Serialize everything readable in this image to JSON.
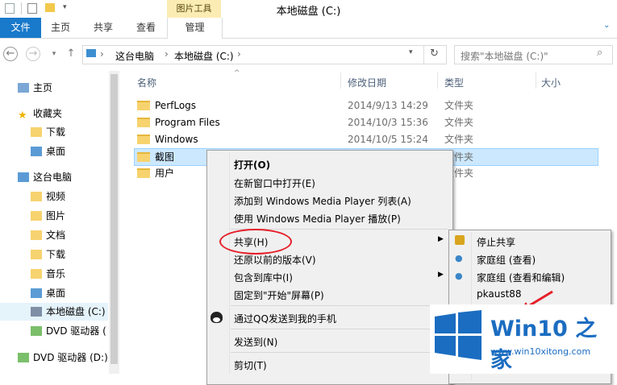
{
  "window": {
    "title": "本地磁盘 (C:)",
    "context_tab_label": "图片工具"
  },
  "ribbon": {
    "file": "文件",
    "tabs": [
      "主页",
      "共享",
      "查看"
    ],
    "manage": "管理"
  },
  "address": {
    "path": [
      "这台电脑",
      "本地磁盘 (C:)"
    ],
    "search_placeholder": "搜索\"本地磁盘 (C:)\""
  },
  "nav": {
    "items": [
      {
        "label": "主页",
        "icon": "home-icon"
      },
      {
        "label": "收藏夹",
        "icon": "star-icon"
      },
      {
        "label": "下载",
        "icon": "download-folder-icon"
      },
      {
        "label": "桌面",
        "icon": "desktop-icon"
      },
      {
        "label": "这台电脑",
        "icon": "computer-icon"
      },
      {
        "label": "视频",
        "icon": "video-folder-icon"
      },
      {
        "label": "图片",
        "icon": "pictures-folder-icon"
      },
      {
        "label": "文档",
        "icon": "documents-folder-icon"
      },
      {
        "label": "下载",
        "icon": "download-folder-icon"
      },
      {
        "label": "音乐",
        "icon": "music-folder-icon"
      },
      {
        "label": "桌面",
        "icon": "desktop-icon"
      },
      {
        "label": "本地磁盘 (C:)",
        "icon": "drive-icon"
      },
      {
        "label": "DVD 驱动器 (",
        "icon": "dvd-drive-icon"
      },
      {
        "label": "DVD 驱动器 (D:)",
        "icon": "dvd-drive-icon"
      }
    ]
  },
  "columns": {
    "name": "名称",
    "modified": "修改日期",
    "type": "类型",
    "size": "大小"
  },
  "files": [
    {
      "name": "PerfLogs",
      "modified": "2014/9/13 14:29",
      "type": "文件夹"
    },
    {
      "name": "Program Files",
      "modified": "2014/10/3 15:36",
      "type": "文件夹"
    },
    {
      "name": "Windows",
      "modified": "2014/10/5 15:24",
      "type": "文件夹"
    },
    {
      "name": "截图",
      "modified": "",
      "type": "文件夹"
    },
    {
      "name": "用户",
      "modified": "",
      "type": "文件夹"
    }
  ],
  "context_menu": {
    "items": [
      "打开(O)",
      "在新窗口中打开(E)",
      "添加到 Windows Media Player 列表(A)",
      "使用 Windows Media Player 播放(P)",
      "共享(H)",
      "还原以前的版本(V)",
      "包含到库中(I)",
      "固定到\"开始\"屏幕(P)",
      "通过QQ发送到我的手机",
      "发送到(N)",
      "剪切(T)"
    ]
  },
  "submenu": {
    "items": [
      "停止共享",
      "家庭组 (查看)",
      "家庭组 (查看和编辑)",
      "pkaust88"
    ]
  },
  "watermark": {
    "brand": "Win10 之家",
    "url": "www.win10xitong.com"
  },
  "colors": {
    "accent": "#1979ca",
    "selection": "#cce8ff",
    "highlight_circle": "#e5202a"
  }
}
